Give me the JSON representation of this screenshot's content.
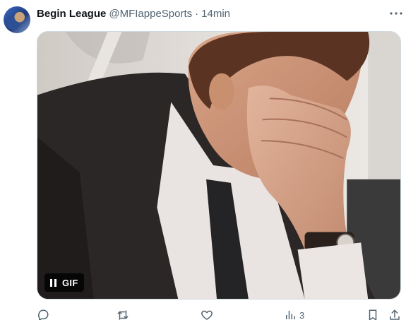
{
  "post": {
    "display_name": "Begin League",
    "handle": "@MFIappeSports",
    "separator": "·",
    "time": "14min"
  },
  "media": {
    "badge": "GIF"
  },
  "actions": {
    "views_count": "3"
  },
  "colors": {
    "text": "#0f1419",
    "secondary": "#536471",
    "border": "#cfd9de"
  },
  "icons": [
    "more-icon",
    "pause-icon",
    "reply-icon",
    "repost-icon",
    "like-icon",
    "views-icon",
    "bookmark-icon",
    "share-icon"
  ]
}
